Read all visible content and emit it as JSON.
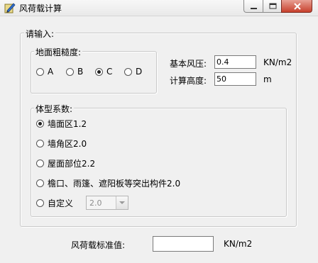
{
  "window": {
    "title": "风荷载计算",
    "icon": "app-pen-icon",
    "controls": [
      "minimize-icon",
      "maximize-icon",
      "close-icon"
    ]
  },
  "input_group": {
    "legend": "请输入:",
    "roughness": {
      "legend": "地面粗糙度:",
      "options": [
        "A",
        "B",
        "C",
        "D"
      ],
      "selected": "C"
    },
    "basic_wind_pressure": {
      "label": "基本风压:",
      "value": "0.4",
      "unit": "KN/m2"
    },
    "calc_height": {
      "label": "计算高度:",
      "value": "50",
      "unit": "m"
    },
    "shape_coef": {
      "legend": "体型系数:",
      "options": [
        "墙面区1.2",
        "墙角区2.0",
        "屋面部位2.2",
        "檐口、雨篷、遮阳板等突出构件2.0",
        "自定义"
      ],
      "selected": "墙面区1.2",
      "custom_value": "2.0"
    }
  },
  "result": {
    "label": "风荷载标准值:",
    "value": "",
    "unit": "KN/m2"
  }
}
